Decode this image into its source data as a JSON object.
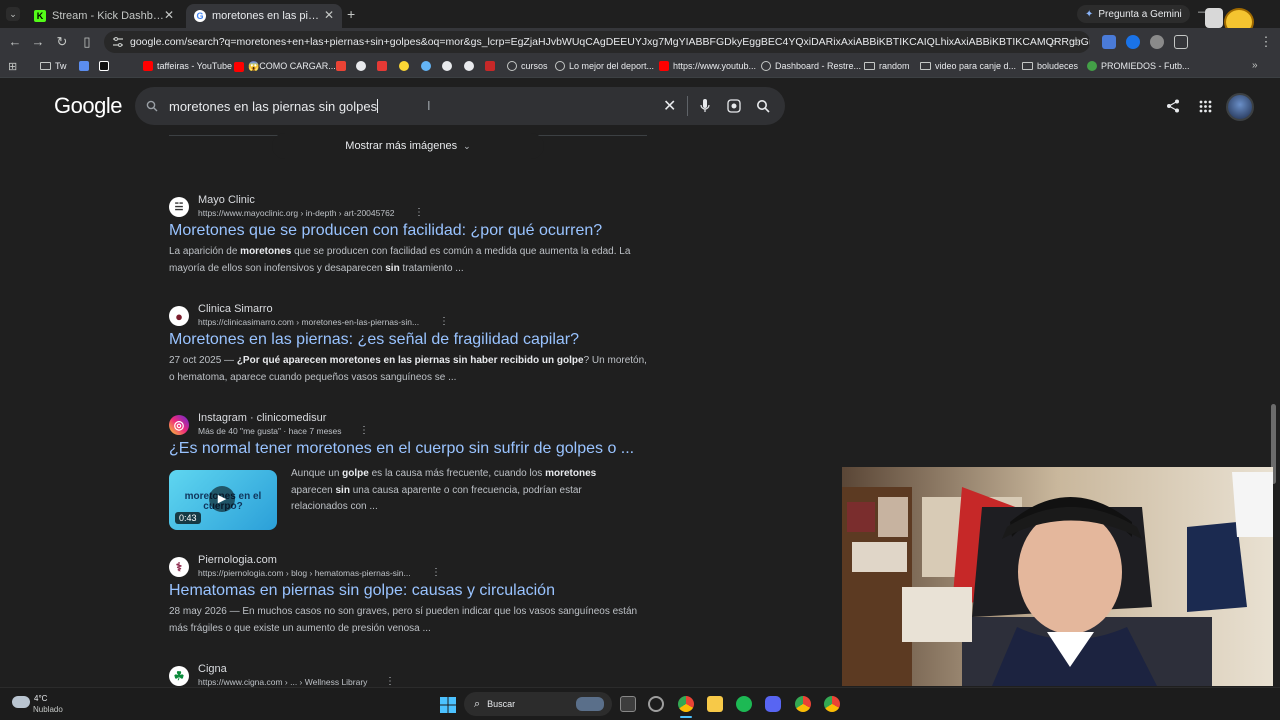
{
  "browser": {
    "tabs": [
      {
        "title": "Stream - Kick Dashboard",
        "favicon": "K"
      },
      {
        "title": "moretones en las piernas sin golpes - Buscar con Google",
        "favicon": "G"
      }
    ],
    "gemini_label": "Pregunta a Gemini",
    "url": "google.com/search?q=moretones+en+las+piernas+sin+golpes&oq=mor&gs_lcrp=EgZjaHJvbWUqCAgDEEUYJxg7MgYIABBFGDkyEggBEC4YQxiDARixAxiABBiKBTIKCAIQLhixAxiABBiKBTIKCAMQRRgnGDsyBggEEEUYPTIGCAUQ..."
  },
  "bookmarks": [
    {
      "label": "Tw",
      "type": "folder"
    },
    {
      "label": "",
      "type": "tiktok"
    },
    {
      "label": "taffeiras - YouTube",
      "type": "youtube"
    },
    {
      "label": "😱COMO CARGAR...",
      "type": "youtube"
    },
    {
      "label": "",
      "type": "gmail"
    },
    {
      "label": "",
      "type": "icon"
    },
    {
      "label": "",
      "type": "icon"
    },
    {
      "label": "",
      "type": "icon"
    },
    {
      "label": "",
      "type": "icon"
    },
    {
      "label": "",
      "type": "icon"
    },
    {
      "label": "",
      "type": "icon"
    },
    {
      "label": "",
      "type": "icon"
    },
    {
      "label": "cursos",
      "type": "globe"
    },
    {
      "label": "Lo mejor del deport...",
      "type": "globe"
    },
    {
      "label": "https://www.youtub...",
      "type": "youtube"
    },
    {
      "label": "Dashboard - Restre...",
      "type": "globe"
    },
    {
      "label": "random",
      "type": "folder"
    },
    {
      "label": "video para canje d...",
      "type": "folder"
    },
    {
      "label": "boludeces",
      "type": "folder"
    },
    {
      "label": "PROMIEDOS - Futb...",
      "type": "icon"
    }
  ],
  "google": {
    "logo": "Google",
    "query": "moretones en las piernas sin golpes",
    "show_more_images": "Mostrar más imágenes"
  },
  "results": [
    {
      "site": "Mayo Clinic",
      "url": "https://www.mayoclinic.org › in-depth › art-20045762",
      "title": "Moretones que se producen con facilidad: ¿por qué ocurren?",
      "snippet_parts": [
        {
          "t": "La aparición de ",
          "b": false
        },
        {
          "t": "moretones",
          "b": true
        },
        {
          "t": " que se producen con facilidad es común a medida que aumenta la edad. La mayoría de ellos son inofensivos y desaparecen ",
          "b": false
        },
        {
          "t": "sin",
          "b": true
        },
        {
          "t": " tratamiento ...",
          "b": false
        }
      ],
      "icon_color": "#ffffff",
      "icon_text": "☱"
    },
    {
      "site": "Clinica Simarro",
      "url": "https://clinicasimarro.com › moretones-en-las-piernas-sin...",
      "title": "Moretones en las piernas: ¿es señal de fragilidad capilar?",
      "snippet_parts": [
        {
          "t": "27 oct 2025 — ",
          "b": false
        },
        {
          "t": "¿Por qué aparecen moretones en las piernas sin haber recibido un golpe",
          "b": true
        },
        {
          "t": "? Un moretón, o hematoma, aparece cuando pequeños vasos sanguíneos se ...",
          "b": false
        }
      ],
      "icon_color": "#ffffff",
      "icon_text": "●"
    },
    {
      "site": "Instagram · clinicomedisur",
      "url": "Más de 40 \"me gusta\" · hace 7 meses",
      "title": "¿Es normal tener moretones en el cuerpo sin sufrir de golpes o ...",
      "snippet_parts": [
        {
          "t": "Aunque un ",
          "b": false
        },
        {
          "t": "golpe",
          "b": true
        },
        {
          "t": " es la causa más frecuente, cuando los ",
          "b": false
        },
        {
          "t": "moretones",
          "b": true
        },
        {
          "t": " aparecen ",
          "b": false
        },
        {
          "t": "sin",
          "b": true
        },
        {
          "t": " una causa aparente o con frecuencia, podrían estar relacionados con ...",
          "b": false
        }
      ],
      "video_duration": "0:43",
      "video_caption": "moretones en el cuerpo?",
      "icon_color": "#d6249f",
      "icon_text": "◎"
    },
    {
      "site": "Piernologia.com",
      "url": "https://piernologia.com › blog › hematomas-piernas-sin...",
      "title": "Hematomas en piernas sin golpe: causas y circulación",
      "snippet_parts": [
        {
          "t": "28 may 2026 — En muchos casos no son graves, pero sí pueden indicar que los vasos sanguíneos están más frágiles o que existe un aumento de presión venosa ...",
          "b": false
        }
      ],
      "icon_color": "#ffffff",
      "icon_text": "⚕"
    },
    {
      "site": "Cigna",
      "url": "https://www.cigna.com › ... › Wellness Library",
      "title": "",
      "snippet_parts": [],
      "icon_color": "#ffffff",
      "icon_text": "☘"
    }
  ],
  "taskbar": {
    "weather_temp": "4°C",
    "weather_desc": "Nublado",
    "search_label": "Buscar"
  }
}
